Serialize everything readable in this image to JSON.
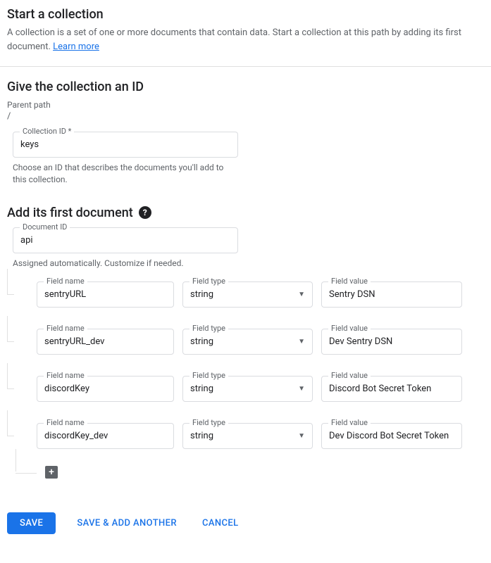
{
  "header": {
    "title": "Start a collection",
    "subtitle": "A collection is a set of one or more documents that contain data. Start a collection at this path by adding its first document. ",
    "learn_more": "Learn more"
  },
  "collection": {
    "section_title": "Give the collection an ID",
    "parent_path_label": "Parent path",
    "parent_path_value": "/",
    "id_label": "Collection ID *",
    "id_value": "keys",
    "id_hint": "Choose an ID that describes the documents you'll add to this collection."
  },
  "document": {
    "section_title": "Add its first document",
    "id_label": "Document ID",
    "id_value": "api",
    "id_hint": "Assigned automatically. Customize if needed.",
    "field_name_label": "Field name",
    "field_type_label": "Field type",
    "field_value_label": "Field value",
    "fields": [
      {
        "name": "sentryURL",
        "type": "string",
        "value": "Sentry DSN"
      },
      {
        "name": "sentryURL_dev",
        "type": "string",
        "value": "Dev Sentry DSN"
      },
      {
        "name": "discordKey",
        "type": "string",
        "value": "Discord Bot Secret Token"
      },
      {
        "name": "discordKey_dev",
        "type": "string",
        "value": "Dev Discord Bot Secret Token"
      }
    ]
  },
  "actions": {
    "save": "SAVE",
    "save_add": "SAVE & ADD ANOTHER",
    "cancel": "CANCEL"
  }
}
